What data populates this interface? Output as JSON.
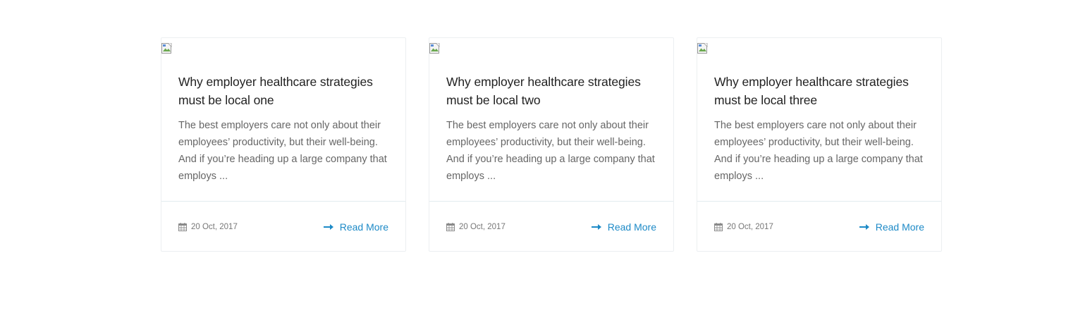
{
  "posts": [
    {
      "title": "Why employer healthcare strategies must be local one",
      "excerpt": "The best employers care not only about their employees’ productivity, but their well-being. And if you’re heading up a large company that employs ...",
      "date": "20 Oct, 2017",
      "read_more": "Read More",
      "thumbnail_icon": "broken-image-icon"
    },
    {
      "title": "Why employer healthcare strategies must be local two",
      "excerpt": "The best employers care not only about their employees’ productivity, but their well-being. And if you’re heading up a large company that employs ...",
      "date": "20 Oct, 2017",
      "read_more": "Read More",
      "thumbnail_icon": "broken-image-icon"
    },
    {
      "title": "Why employer healthcare strategies must be local three",
      "excerpt": "The best employers care not only about their employees’ productivity, but their well-being. And if you’re heading up a large company that employs ...",
      "date": "20 Oct, 2017",
      "read_more": "Read More",
      "thumbnail_icon": "broken-image-icon"
    }
  ],
  "icons": {
    "date": "calendar-icon",
    "read_more": "arrow-right-icon"
  },
  "colors": {
    "accent": "#1d8ac7",
    "title": "#222222",
    "body_text": "#666666",
    "meta_text": "#777777",
    "border": "#eceff1"
  }
}
